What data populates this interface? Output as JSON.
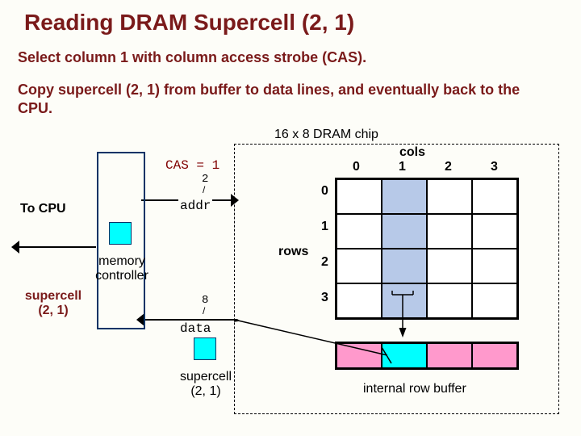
{
  "title": "Reading DRAM Supercell (2, 1)",
  "body_line1": "Select column 1 with column access strobe (CAS).",
  "body_line2": "Copy supercell (2, 1) from buffer to data lines, and eventually back to the CPU.",
  "chip_label": "16 x 8 DRAM chip",
  "cols_label": "cols",
  "rows_label": "rows",
  "col_nums": [
    "0",
    "1",
    "2",
    "3"
  ],
  "row_nums": [
    "0",
    "1",
    "2",
    "3"
  ],
  "cas_text": "CAS = 1",
  "addr_bus_width": "2",
  "addr_tick": "/",
  "addr_label": "addr",
  "data_bus_width": "8",
  "data_tick": "/",
  "data_label": "data",
  "to_cpu": "To CPU",
  "memctrl": "memory controller",
  "supercell_left": "supercell (2, 1)",
  "supercell_data": "supercell (2, 1)",
  "rowbuf_label": "internal row buffer",
  "highlight_col": 1,
  "highlight_buf_cell": 1
}
